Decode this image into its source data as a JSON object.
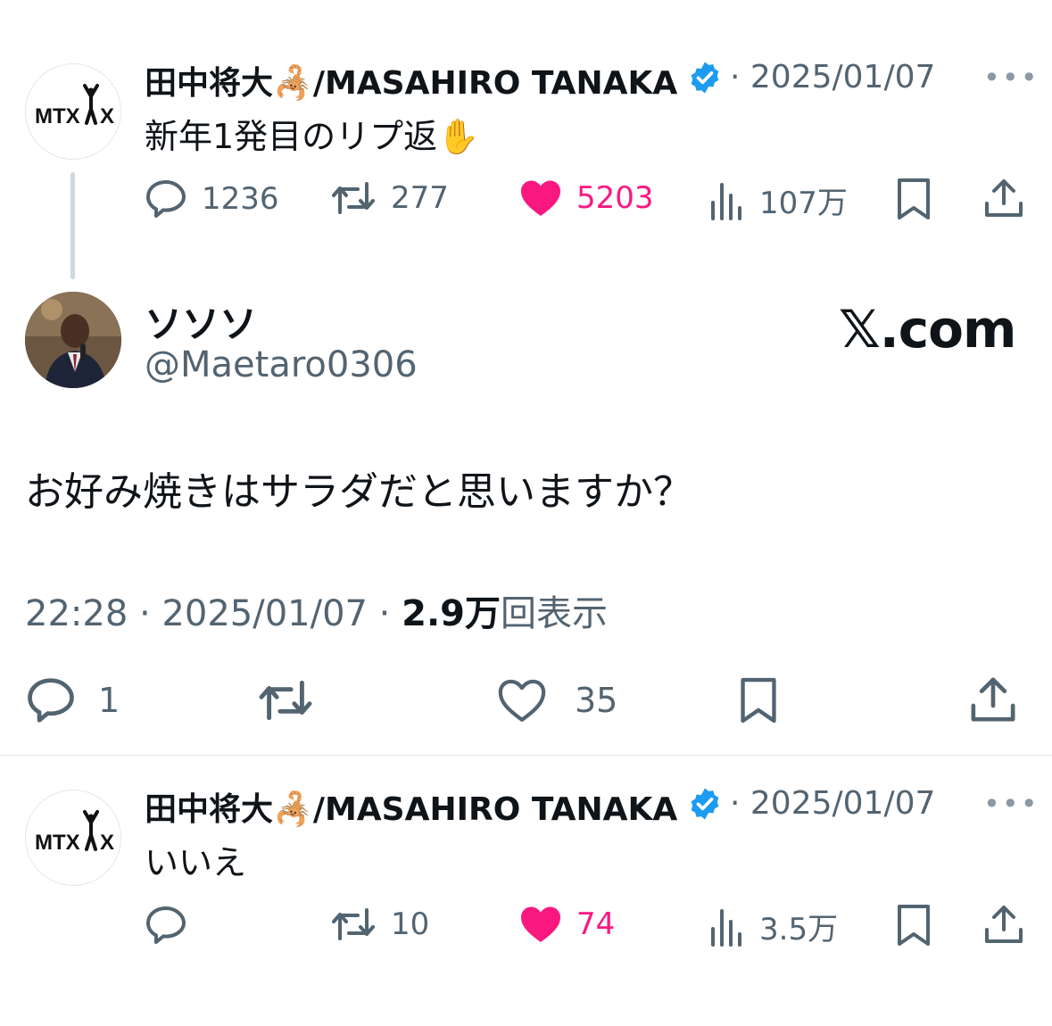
{
  "colors": {
    "text": "#0f1419",
    "secondary": "#536471",
    "like": "#f91880",
    "verified": "#1d9bf0",
    "divider": "#e3e7ea"
  },
  "tweet1": {
    "avatar_text": "MTX X",
    "name": "田中将大🦂/MASAHIRO TANAKA",
    "date": "· 2025/01/07",
    "more": "•••",
    "text": "新年1発目のリプ返✋",
    "replies": "1236",
    "retweets": "277",
    "likes": "5203",
    "views": "107万"
  },
  "quoted": {
    "name": "ソソソ",
    "handle": "@Maetaro0306",
    "brand": "𝕏.com",
    "text": "お好み焼きはサラダだと思いますか？",
    "time_date": "22:28 · 2025/01/07 · ",
    "views_count": "2.9万",
    "views_label": "回表示",
    "replies": "1",
    "likes": "35"
  },
  "tweet2": {
    "avatar_text": "MTX X",
    "name": "田中将大🦂/MASAHIRO TANAKA",
    "date": "· 2025/01/07",
    "more": "•••",
    "text": "いいえ",
    "retweets": "10",
    "likes": "74",
    "views": "3.5万"
  },
  "icons": [
    "reply-icon",
    "retweet-icon",
    "heart-icon",
    "views-icon",
    "bookmark-icon",
    "share-icon",
    "verified-badge-icon",
    "more-icon"
  ]
}
